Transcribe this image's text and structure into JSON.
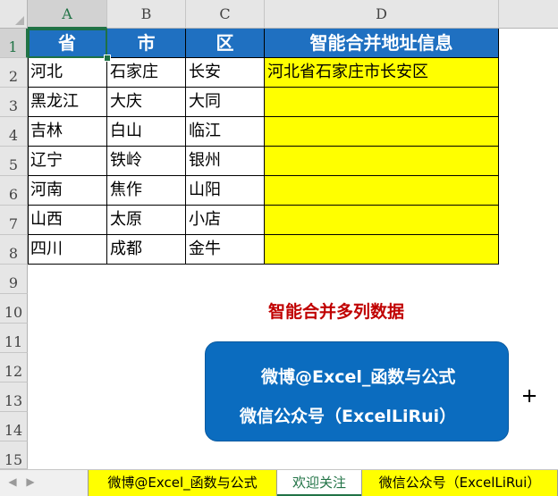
{
  "columns": [
    "A",
    "B",
    "C",
    "D"
  ],
  "rows": [
    "1",
    "2",
    "3",
    "4",
    "5",
    "6",
    "7",
    "8",
    "9",
    "10",
    "11",
    "12",
    "13",
    "14",
    "15"
  ],
  "table": {
    "headers": [
      "省",
      "市",
      "区",
      "智能合并地址信息"
    ],
    "data": [
      [
        "河北",
        "石家庄",
        "长安",
        "河北省石家庄市长安区"
      ],
      [
        "黑龙江",
        "大庆",
        "大同",
        ""
      ],
      [
        "吉林",
        "白山",
        "临江",
        ""
      ],
      [
        "辽宁",
        "铁岭",
        "银州",
        ""
      ],
      [
        "河南",
        "焦作",
        "山阳",
        ""
      ],
      [
        "山西",
        "太原",
        "小店",
        ""
      ],
      [
        "四川",
        "成都",
        "金牛",
        ""
      ]
    ]
  },
  "annotation": {
    "red_title": "智能合并多列数据",
    "box_line1": "微博@Excel_函数与公式",
    "box_line2": "微信公众号（ExcelLiRui）"
  },
  "tabs": [
    {
      "label": "微博@Excel_函数与公式",
      "active": false
    },
    {
      "label": "欢迎关注",
      "active": true
    },
    {
      "label": "微信公众号（ExcelLiRui）",
      "active": false
    }
  ],
  "colors": {
    "header_fill": "#1f70c1",
    "highlight": "#ffff00",
    "title_red": "#c00000",
    "box_blue": "#0b6cbf",
    "excel_green": "#217346"
  }
}
